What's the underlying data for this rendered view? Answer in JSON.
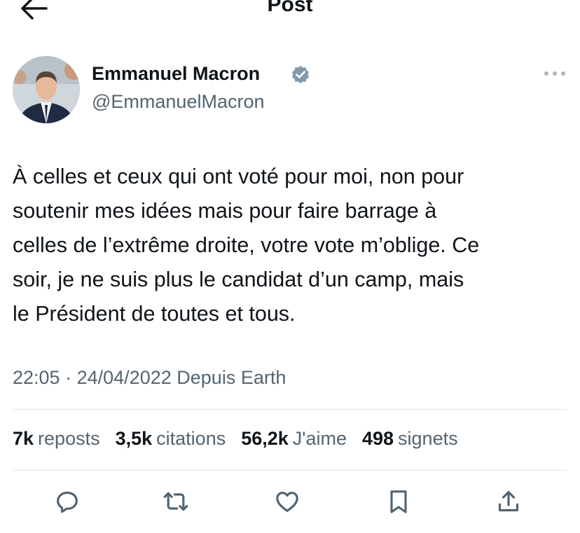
{
  "header": {
    "title": "Post",
    "back_icon": "arrow-left-icon"
  },
  "author": {
    "name": "Emmanuel Macron",
    "handle": "@EmmanuelMacron",
    "verified_icon": "verified-badge-icon",
    "verified_color": "#829aab"
  },
  "tweet": {
    "text": "À celles et ceux qui ont voté pour moi, non pour\nsoutenir mes idées mais pour faire barrage à\ncelles de l’extrême droite, votre vote m’oblige. Ce\nsoir, je ne suis plus le candidat d’un camp, mais\nle Président de toutes et tous.",
    "time": "22:05",
    "date": "24/04/2022",
    "separator": "·",
    "source": "Depuis Earth"
  },
  "stats": [
    {
      "value": "7k",
      "label": "reposts"
    },
    {
      "value": "3,5k",
      "label": "citations"
    },
    {
      "value": "56,2k",
      "label": "J'aime"
    },
    {
      "value": "498",
      "label": "signets"
    }
  ],
  "actions": [
    {
      "name": "reply",
      "icon": "comment-icon"
    },
    {
      "name": "repost",
      "icon": "repost-icon"
    },
    {
      "name": "like",
      "icon": "heart-icon"
    },
    {
      "name": "bookmark",
      "icon": "bookmark-icon"
    },
    {
      "name": "share",
      "icon": "share-icon"
    }
  ],
  "colors": {
    "text": "#0f1419",
    "secondary": "#536471",
    "divider": "#e1e5e9",
    "icon": "#536471"
  }
}
